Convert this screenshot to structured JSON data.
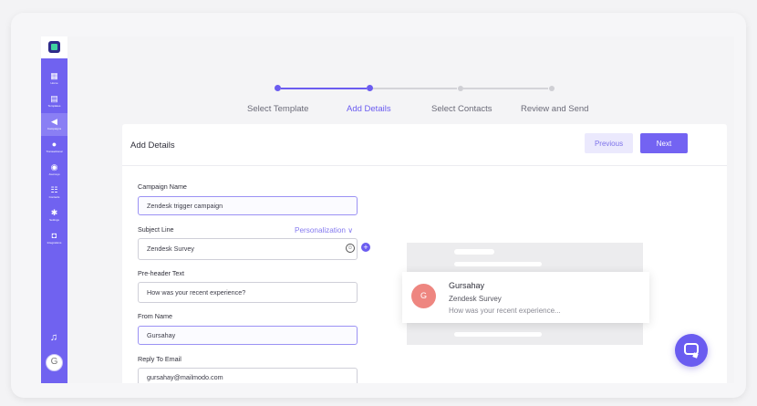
{
  "sidebar": {
    "items": [
      {
        "label": "Home",
        "icon": "grid-icon",
        "glyph": "▦"
      },
      {
        "label": "Templates",
        "icon": "templates-icon",
        "glyph": "▤"
      },
      {
        "label": "Campaigns",
        "icon": "megaphone-icon",
        "glyph": "◀"
      },
      {
        "label": "Transactional",
        "icon": "transactional-icon",
        "glyph": "●"
      },
      {
        "label": "Journeys",
        "icon": "journeys-icon",
        "glyph": "◉"
      },
      {
        "label": "Contacts",
        "icon": "contacts-icon",
        "glyph": "☷"
      },
      {
        "label": "Settings",
        "icon": "gear-icon",
        "glyph": "✱"
      },
      {
        "label": "Integrations",
        "icon": "integrations-icon",
        "glyph": "◘"
      }
    ],
    "active_index": 2,
    "bell_glyph": "♫",
    "avatar_initial": "G"
  },
  "stepper": {
    "steps": [
      {
        "label": "Select Template",
        "state": "done"
      },
      {
        "label": "Add Details",
        "state": "current"
      },
      {
        "label": "Select Contacts",
        "state": "pending"
      },
      {
        "label": "Review and Send",
        "state": "pending"
      }
    ]
  },
  "panel": {
    "title": "Add Details",
    "previous_label": "Previous",
    "next_label": "Next"
  },
  "form": {
    "campaign_name": {
      "label": "Campaign Name",
      "value": "Zendesk trigger campaign"
    },
    "subject_line": {
      "label": "Subject Line",
      "value": "Zendesk Survey",
      "personalization_label": "Personalization ∨"
    },
    "preheader": {
      "label": "Pre-header Text",
      "value": "How was your recent experience?"
    },
    "from_name": {
      "label": "From Name",
      "value": "Gursahay"
    },
    "reply_to": {
      "label": "Reply To Email",
      "value": "gursahay@mailmodo.com"
    }
  },
  "preview": {
    "avatar_initial": "G",
    "sender": "Gursahay",
    "subject": "Zendesk Survey",
    "preheader": "How was your recent experience..."
  },
  "colors": {
    "accent": "#6b5cf0",
    "sidebar": "#7062f0",
    "preview_avatar": "#ee8680"
  }
}
